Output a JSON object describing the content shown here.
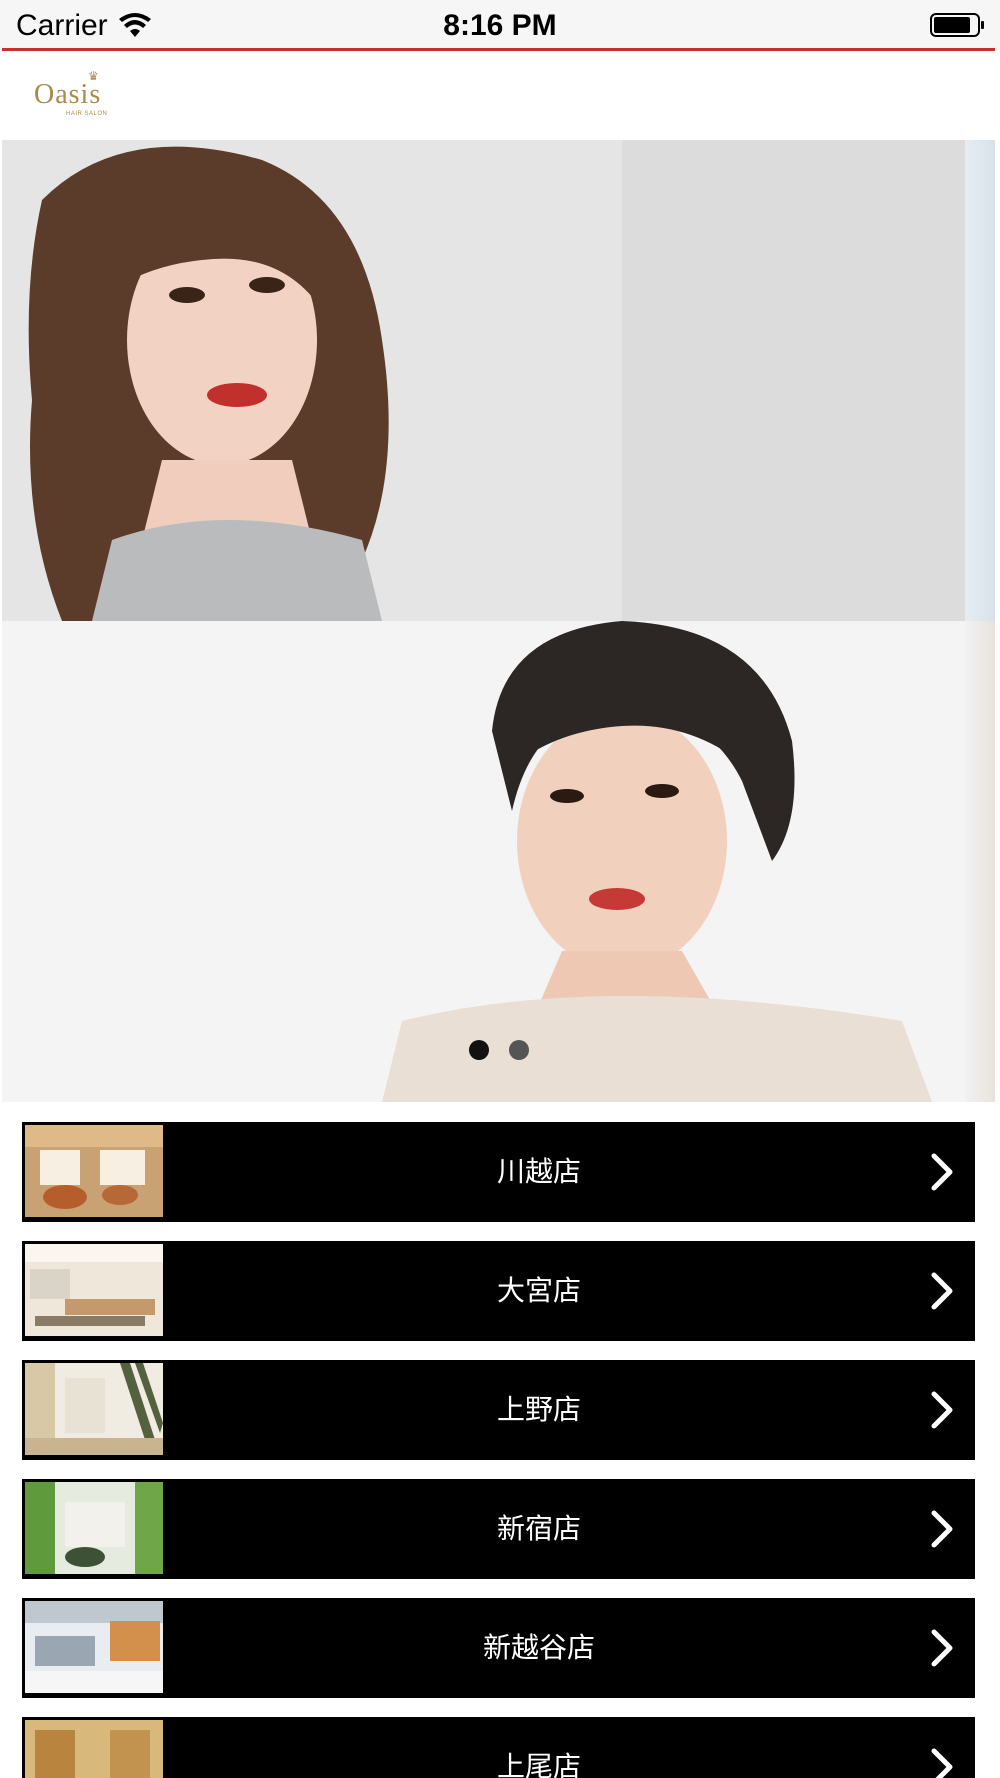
{
  "status_bar": {
    "carrier": "Carrier",
    "time": "8:16 PM"
  },
  "header": {
    "logo_text": "Oasis",
    "logo_subtext": "HAIR SALON"
  },
  "carousel": {
    "slide_count": 2,
    "active_index": 0,
    "slides": [
      {
        "description_icon": "photo-icon"
      },
      {
        "description_icon": "photo-icon"
      }
    ]
  },
  "stores": [
    {
      "name": "川越店"
    },
    {
      "name": "大宮店"
    },
    {
      "name": "上野店"
    },
    {
      "name": "新宿店"
    },
    {
      "name": "新越谷店"
    },
    {
      "name": "上尾店"
    }
  ],
  "colors": {
    "accent_red": "#c4302b",
    "logo_gold": "#a88a4a",
    "row_background": "#000000"
  }
}
